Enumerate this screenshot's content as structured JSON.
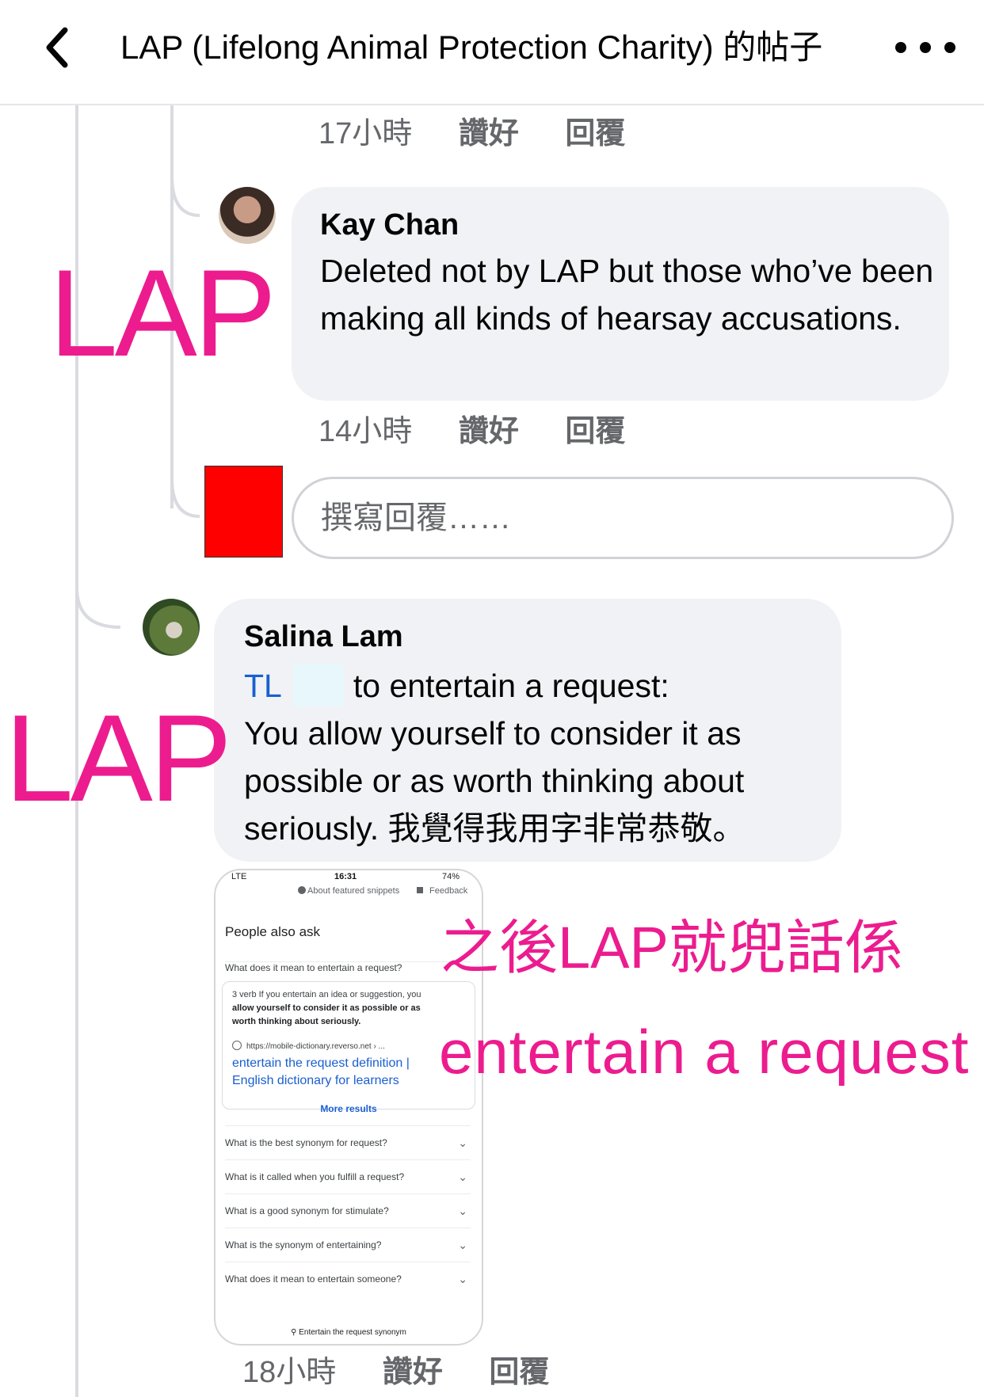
{
  "header": {
    "title": "LAP (Lifelong Animal Protection Charity) 的帖子"
  },
  "actions": {
    "like": "讚好",
    "reply": "回覆"
  },
  "comments": [
    {
      "time": "17小時"
    },
    {
      "author": "Kay Chan",
      "text": "Deleted not by LAP but those who’ve been making all kinds of hearsay accusations.",
      "time": "14小時"
    },
    {
      "author": "Salina Lam",
      "mention": "TL",
      "text_line1": "to entertain a request:",
      "text_rest": "You allow yourself to consider it as possible or as worth thinking about seriously. 我覺得我用字非常恭敬。",
      "time": "18小時"
    }
  ],
  "reply_box": {
    "placeholder": "撰寫回覆……"
  },
  "overlays": {
    "lap_label_1": "LAP",
    "lap_label_2": "LAP",
    "pink_line_1": "之後LAP就兜話係",
    "pink_line_2": "entertain a request"
  },
  "screenshot": {
    "status_carrier": "LTE",
    "status_time": "16:31",
    "status_battery": "74%",
    "about_snippets": "About featured snippets",
    "feedback": "Feedback",
    "section_title": "People also ask",
    "question_open": "What does it mean to entertain a request?",
    "answer_line1": "3 verb If you entertain an idea or suggestion, you",
    "answer_line2": "allow yourself to consider it as possible or as",
    "answer_line3": "worth thinking about seriously.",
    "source_url": "https://mobile-dictionary.reverso.net › ...",
    "link_line1": "entertain the request definition |",
    "link_line2": "English dictionary for learners",
    "more_results": "More results",
    "questions": [
      "What is the best synonym for request?",
      "What is it called when you fulfill a request?",
      "What is a good synonym for stimulate?",
      "What is the synonym of entertaining?",
      "What does it mean to entertain someone?"
    ],
    "search_bar": "Entertain the request synonym"
  },
  "colors": {
    "overlay_pink": "#ec1c8f",
    "link_blue": "#1a5fd0",
    "redaction_red": "#ff0000"
  }
}
